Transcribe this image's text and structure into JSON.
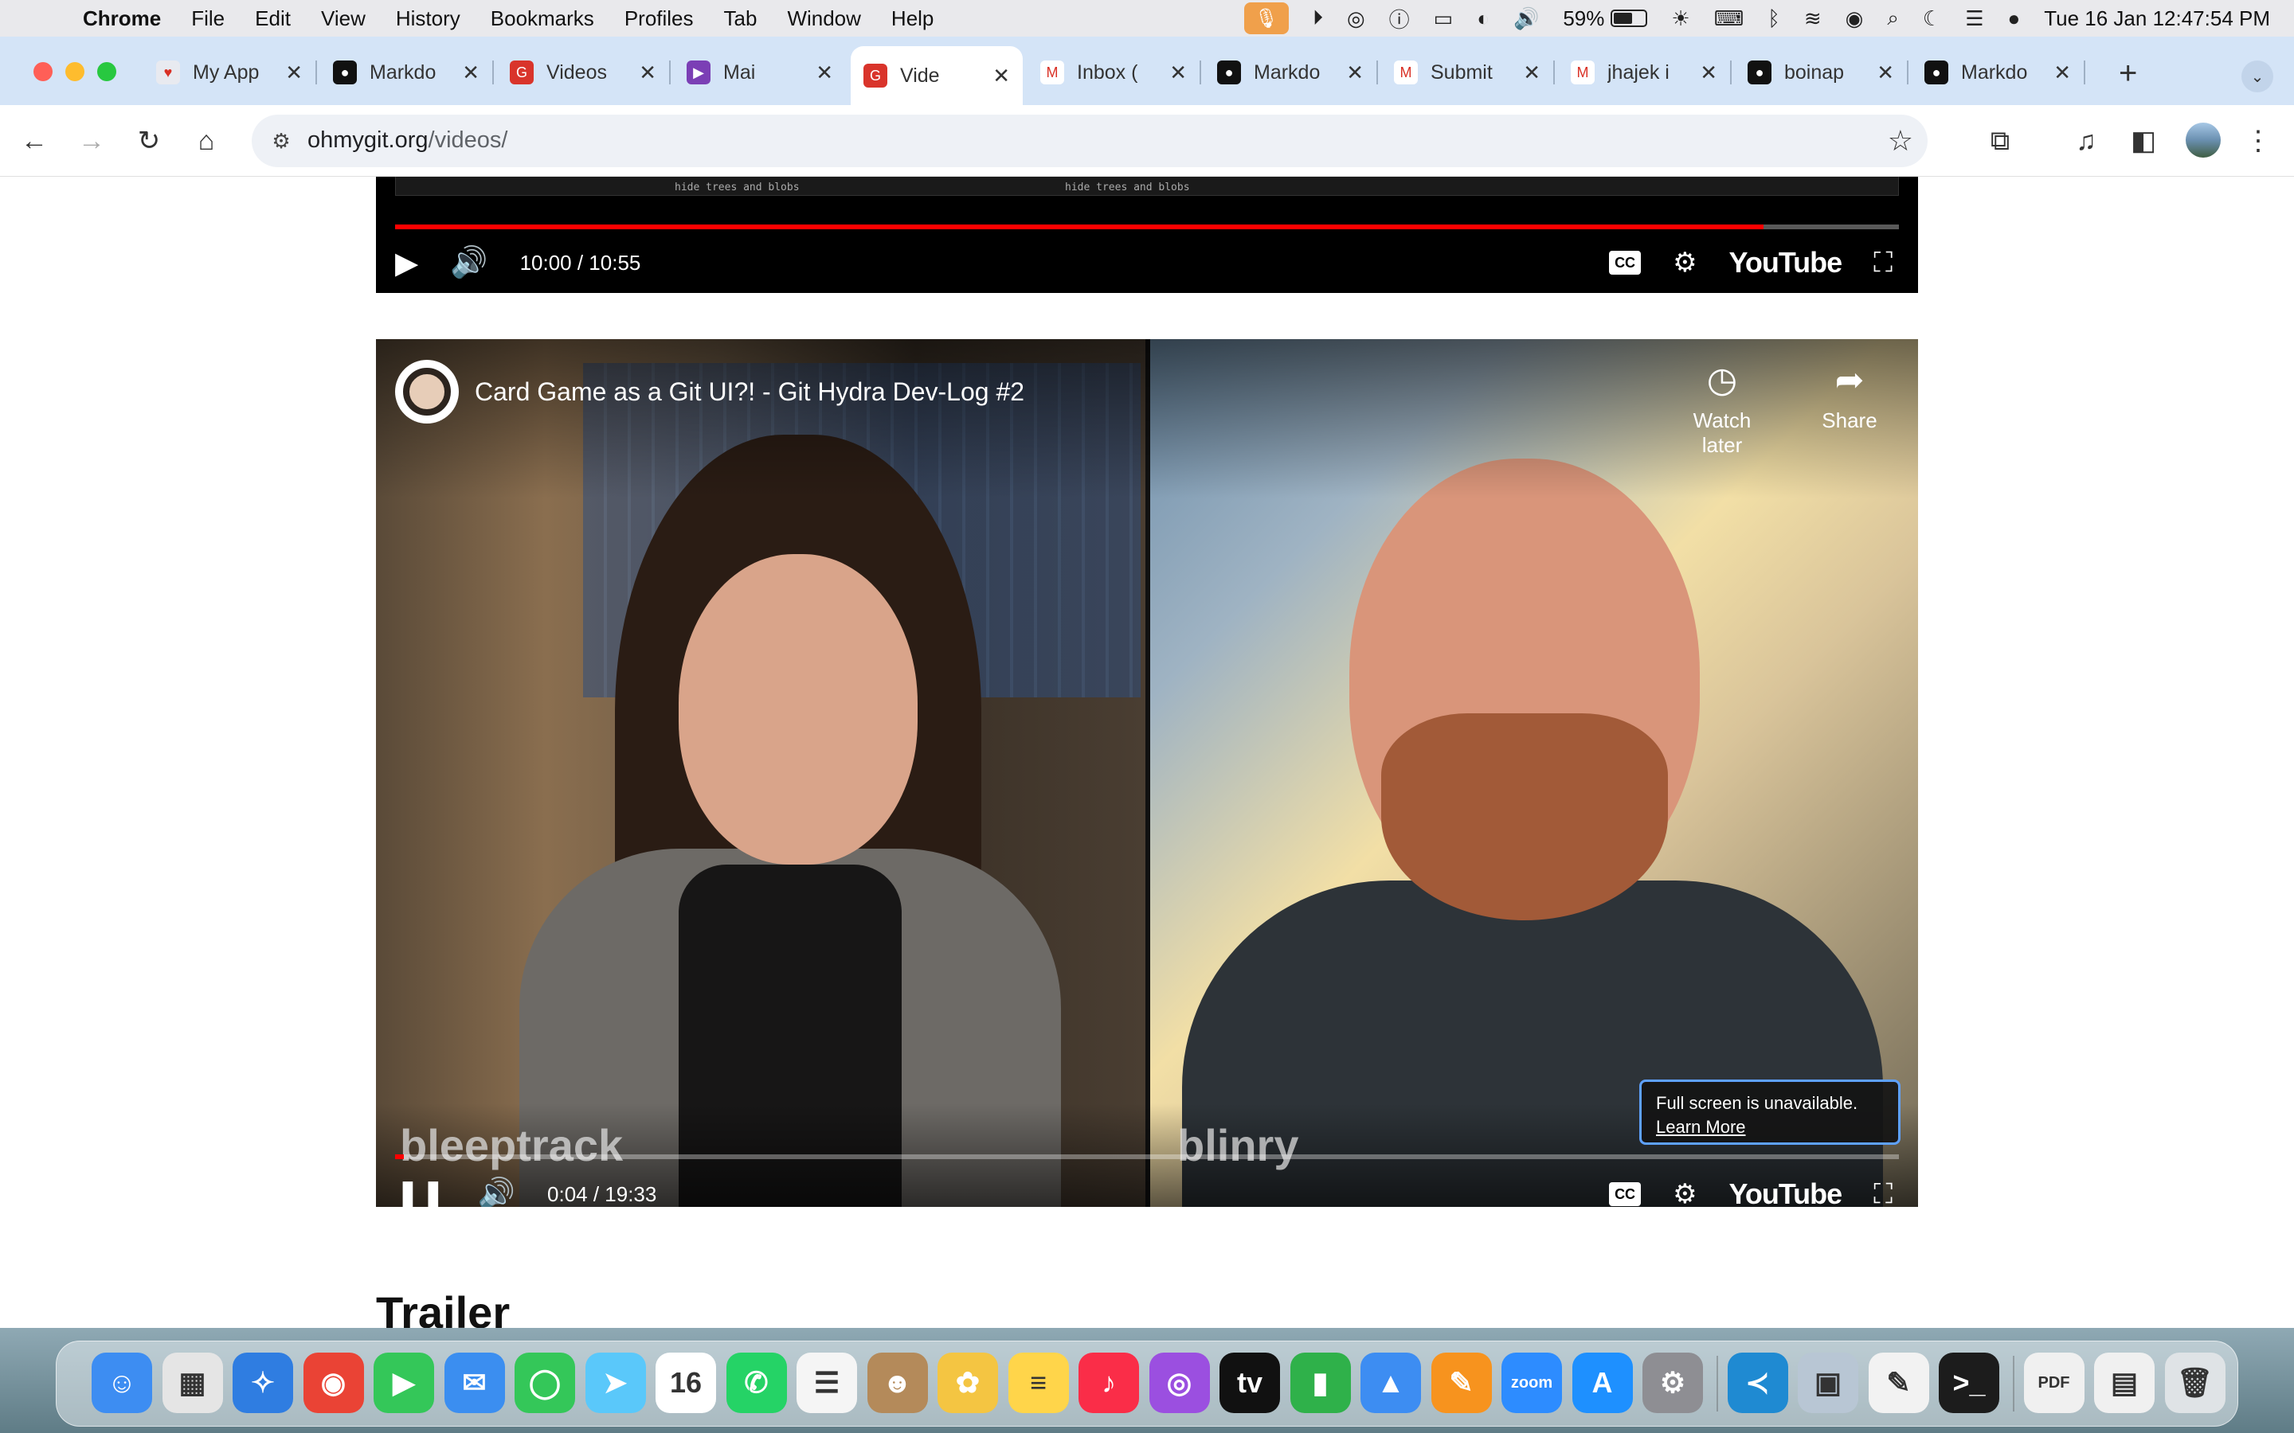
{
  "menubar": {
    "app": "Chrome",
    "items": [
      "File",
      "Edit",
      "View",
      "History",
      "Bookmarks",
      "Profiles",
      "Tab",
      "Window",
      "Help"
    ],
    "battery": "59%",
    "datetime": "Tue 16 Jan  12:47:54 PM"
  },
  "tabs": [
    {
      "title": "My App",
      "color": "#e8eaf0",
      "fav": "♥"
    },
    {
      "title": "Markdo",
      "color": "#111111",
      "fav": "●"
    },
    {
      "title": "Videos",
      "color": "#d9342b",
      "fav": "G"
    },
    {
      "title": "Mai",
      "color": "#7b3fb5",
      "fav": "▶"
    },
    {
      "title": "Vide",
      "color": "#d9342b",
      "fav": "G"
    },
    {
      "title": "Inbox (",
      "color": "#ffffff",
      "fav": "M"
    },
    {
      "title": "Markdo",
      "color": "#111111",
      "fav": "●"
    },
    {
      "title": "Submit",
      "color": "#ffffff",
      "fav": "M"
    },
    {
      "title": "jhajek i",
      "color": "#ffffff",
      "fav": "M"
    },
    {
      "title": "boinap",
      "color": "#111111",
      "fav": "●"
    },
    {
      "title": "Markdo",
      "color": "#111111",
      "fav": "●"
    }
  ],
  "address": {
    "host": "ohmygit.org",
    "path": "/videos/"
  },
  "video1": {
    "time": "10:00 / 10:55",
    "progress": 0.91,
    "strip_hint_a": "hide trees and blobs",
    "strip_hint_b": "hide trees and blobs",
    "brand": "YouTube",
    "cc": "CC"
  },
  "video2": {
    "title": "Card Game as a Git UI?! - Git Hydra Dev-Log #2",
    "watch_later": "Watch later",
    "share": "Share",
    "time": "0:04 / 19:33",
    "progress": 0.003,
    "name_left": "bleeptrack",
    "name_right": "blinry",
    "brand": "YouTube",
    "cc": "CC",
    "tooltip_text": "Full screen is unavailable.",
    "tooltip_link": "Learn More"
  },
  "page": {
    "section_heading": "Trailer"
  },
  "dock": [
    {
      "name": "finder",
      "color": "#3d8df2",
      "glyph": "☺"
    },
    {
      "name": "launchpad",
      "color": "#e5e5e5",
      "glyph": "▦"
    },
    {
      "name": "safari",
      "color": "#2f7de1",
      "glyph": "✧"
    },
    {
      "name": "chrome",
      "color": "#ea4335",
      "glyph": "◉"
    },
    {
      "name": "facetime",
      "color": "#34c759",
      "glyph": "▶"
    },
    {
      "name": "mail",
      "color": "#3b8ef0",
      "glyph": "✉"
    },
    {
      "name": "messages",
      "color": "#34c759",
      "glyph": "◯"
    },
    {
      "name": "maps",
      "color": "#5ac8fa",
      "glyph": "➤"
    },
    {
      "name": "calendar",
      "color": "#ffffff",
      "glyph": "16"
    },
    {
      "name": "whatsapp",
      "color": "#25d366",
      "glyph": "✆"
    },
    {
      "name": "reminders",
      "color": "#f5f5f5",
      "glyph": "☰"
    },
    {
      "name": "contacts",
      "color": "#b48a5a",
      "glyph": "☻"
    },
    {
      "name": "photos",
      "color": "#f4c542",
      "glyph": "✿"
    },
    {
      "name": "notes",
      "color": "#ffd54a",
      "glyph": "≡"
    },
    {
      "name": "music",
      "color": "#fa2d48",
      "glyph": "♪"
    },
    {
      "name": "podcasts",
      "color": "#9b4fe0",
      "glyph": "◎"
    },
    {
      "name": "tv",
      "color": "#111111",
      "glyph": "tv"
    },
    {
      "name": "numbers",
      "color": "#2fb14a",
      "glyph": "▮"
    },
    {
      "name": "keynote",
      "color": "#3d8df2",
      "glyph": "▲"
    },
    {
      "name": "pages",
      "color": "#f7931e",
      "glyph": "✎"
    },
    {
      "name": "zoom",
      "color": "#2d8cff",
      "glyph": "zoom"
    },
    {
      "name": "app-store",
      "color": "#1e90ff",
      "glyph": "A"
    },
    {
      "name": "system-settings",
      "color": "#8e8e93",
      "glyph": "⚙"
    },
    {
      "name": "vscode",
      "color": "#1f8ad2",
      "glyph": "≺"
    },
    {
      "name": "preview",
      "color": "#b8c6d4",
      "glyph": "▣"
    },
    {
      "name": "textedit",
      "color": "#f2f2f2",
      "glyph": "✎"
    },
    {
      "name": "terminal",
      "color": "#1c1c1c",
      "glyph": ">_"
    },
    {
      "name": "pdf-doc",
      "color": "#f0f0f0",
      "glyph": "PDF"
    },
    {
      "name": "document",
      "color": "#f0f0f0",
      "glyph": "▤"
    },
    {
      "name": "trash",
      "color": "#dfe3e6",
      "glyph": "🗑"
    }
  ]
}
